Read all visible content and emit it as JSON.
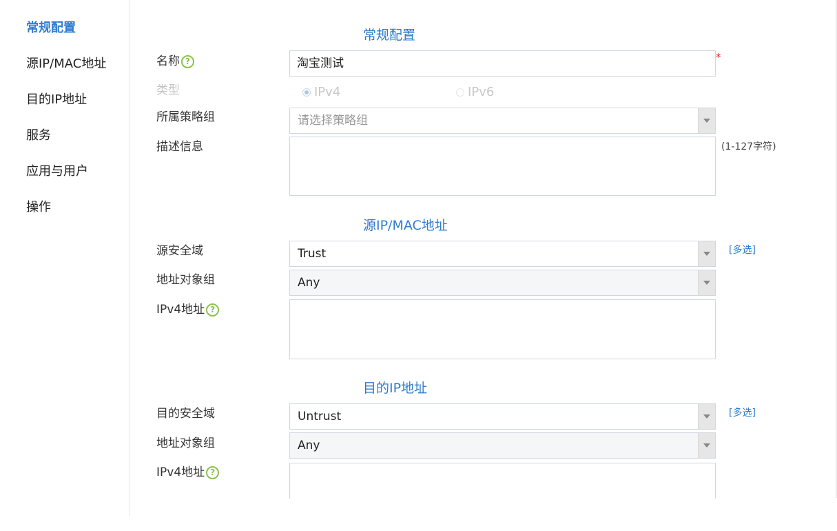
{
  "sidebar": {
    "items": [
      {
        "label": "常规配置",
        "active": true
      },
      {
        "label": "源IP/MAC地址"
      },
      {
        "label": "目的IP地址"
      },
      {
        "label": "服务"
      },
      {
        "label": "应用与用户"
      },
      {
        "label": "操作"
      }
    ]
  },
  "general": {
    "title": "常规配置",
    "name_label": "名称",
    "name_value": "淘宝测试",
    "required_mark": "*",
    "type_label": "类型",
    "type_options": [
      "IPv4",
      "IPv6"
    ],
    "type_selected": "IPv4",
    "group_label": "所属策略组",
    "group_placeholder": "请选择策略组",
    "desc_label": "描述信息",
    "desc_value": "",
    "desc_hint": "(1-127字符)"
  },
  "source": {
    "title": "源IP/MAC地址",
    "zone_label": "源安全域",
    "zone_value": "Trust",
    "multi_label": "[多选]",
    "addr_group_label": "地址对象组",
    "addr_group_value": "Any",
    "ipv4_label": "IPv4地址",
    "ipv4_value": ""
  },
  "destination": {
    "title": "目的IP地址",
    "zone_label": "目的安全域",
    "zone_value": "Untrust",
    "multi_label": "[多选]",
    "addr_group_label": "地址对象组",
    "addr_group_value": "Any",
    "ipv4_label": "IPv4地址",
    "ipv4_value": ""
  },
  "icons": {
    "help": "?"
  },
  "colors": {
    "accent": "#2f7cd1",
    "help": "#8bc34a",
    "required": "#e02020"
  }
}
